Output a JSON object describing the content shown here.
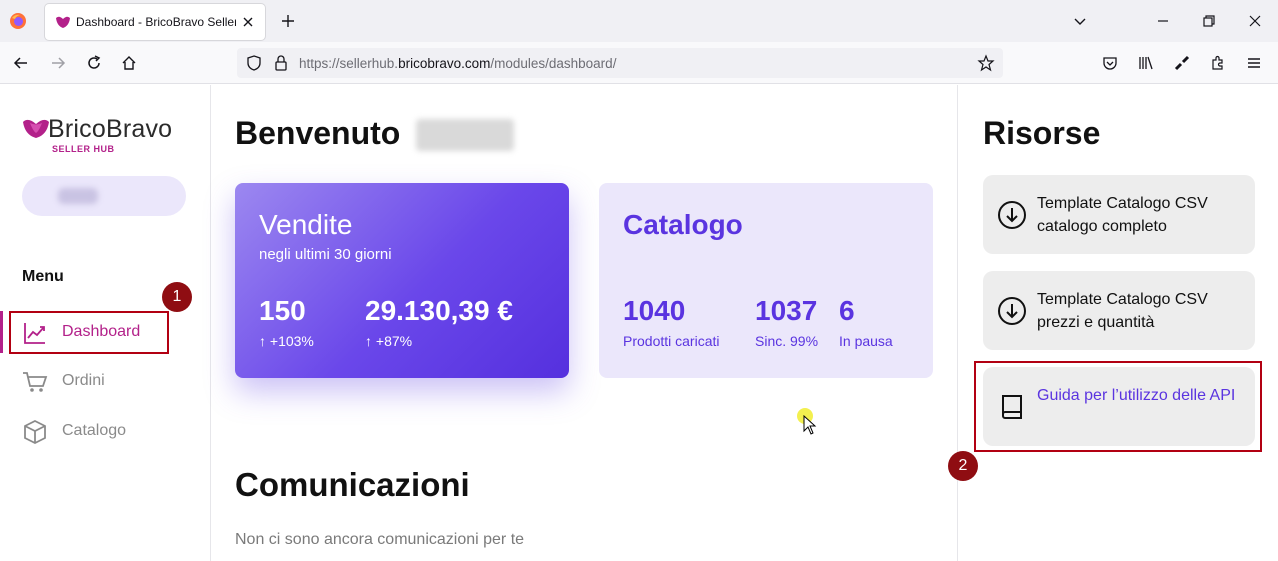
{
  "browser": {
    "tab_title": "Dashboard - BricoBravo Seller Hub",
    "url_prefix": "https://sellerhub.",
    "url_domain": "bricobravo.com",
    "url_path": "/modules/dashboard/"
  },
  "sidebar": {
    "logo_text": "BricoBravo",
    "logo_sub": "SELLER HUB",
    "menu_heading": "Menu",
    "items": [
      {
        "label": "Dashboard",
        "icon": "chart-line-icon",
        "active": true
      },
      {
        "label": "Ordini",
        "icon": "cart-icon",
        "active": false
      },
      {
        "label": "Catalogo",
        "icon": "box-icon",
        "active": false
      }
    ]
  },
  "main": {
    "welcome": "Benvenuto",
    "sales": {
      "title": "Vendite",
      "subtitle": "negli ultimi 30 giorni",
      "count": "150",
      "count_change": "↑ +103%",
      "revenue": "29.130,39 €",
      "revenue_change": "↑ +87%"
    },
    "catalog": {
      "title": "Catalogo",
      "uploaded": "1040",
      "uploaded_label": "Prodotti caricati",
      "synced": "1037",
      "synced_label": "Sinc. 99%",
      "paused": "6",
      "paused_label": "In pausa"
    },
    "communications_title": "Comunicazioni",
    "communications_empty": "Non ci sono ancora comunicazioni per te"
  },
  "resources": {
    "title": "Risorse",
    "items": [
      {
        "text": "Template Catalogo CSV catalogo completo",
        "icon": "download-icon"
      },
      {
        "text": "Template Catalogo CSV prezzi e quantità",
        "icon": "download-icon"
      },
      {
        "text": "Guida per l’utilizzo delle API",
        "icon": "book-icon"
      }
    ]
  },
  "annotations": [
    "1",
    "2"
  ],
  "colors": {
    "brand": "#b3218a",
    "accent": "#5a34e0",
    "annotation": "#b20012"
  }
}
